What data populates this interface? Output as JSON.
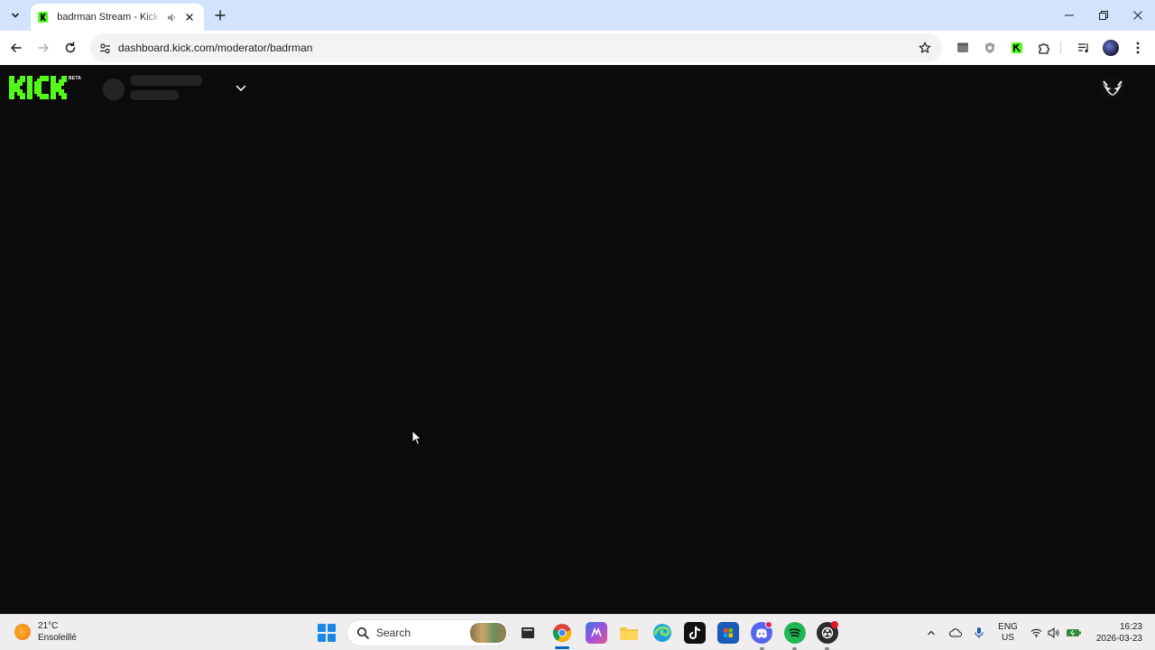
{
  "browser": {
    "tab": {
      "title": "badrman Stream - Kick Dashboard"
    },
    "address_bar": {
      "url": "dashboard.kick.com/moderator/badrman"
    }
  },
  "dashboard": {
    "logo_badge": "BETA"
  },
  "taskbar": {
    "weather": {
      "temperature": "21°C",
      "condition": "Ensoleillé"
    },
    "search": {
      "placeholder": "Search"
    },
    "apps": [
      "file-manager-icon",
      "chrome-icon",
      "m365-icon",
      "file-explorer-icon",
      "edge-icon",
      "tiktok-icon",
      "microsoft-store-icon",
      "discord-icon",
      "spotify-icon",
      "obs-icon"
    ],
    "language": {
      "lang": "ENG",
      "region": "US"
    },
    "clock": {
      "time": "16:23",
      "date": "2026-03-23"
    }
  }
}
